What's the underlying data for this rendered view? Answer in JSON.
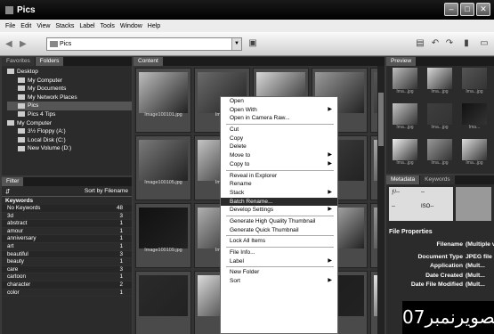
{
  "window": {
    "title": "Pics",
    "buttons": [
      "–",
      "□",
      "✕"
    ]
  },
  "menu": [
    "File",
    "Edit",
    "View",
    "Stacks",
    "Label",
    "Tools",
    "Window",
    "Help"
  ],
  "toolbar": {
    "path": "Pics"
  },
  "left": {
    "tabs": [
      "Favorites",
      "Folders"
    ],
    "tree": [
      "Desktop",
      "My Computer",
      "My Documents",
      "My Network Places",
      "Pics",
      "Pics 4 Tips",
      "My Computer",
      "3½ Floppy (A:)",
      "Local Disk (C:)",
      "New Volume (D:)"
    ],
    "filter_tab": "Filter",
    "sort": "Sort by Filename",
    "keywords_header": "Keywords",
    "keywords": [
      {
        "name": "No Keywords",
        "count": "48"
      },
      {
        "name": "3d",
        "count": "3"
      },
      {
        "name": "abstract",
        "count": "1"
      },
      {
        "name": "amour",
        "count": "1"
      },
      {
        "name": "anniversary",
        "count": "1"
      },
      {
        "name": "art",
        "count": "1"
      },
      {
        "name": "beautiful",
        "count": "3"
      },
      {
        "name": "beauty",
        "count": "1"
      },
      {
        "name": "care",
        "count": "3"
      },
      {
        "name": "cartoon",
        "count": "1"
      },
      {
        "name": "character",
        "count": "2"
      },
      {
        "name": "color",
        "count": "1"
      }
    ]
  },
  "content": {
    "tab": "Content",
    "captions": [
      "Image100101.jpg",
      "Image",
      "",
      "",
      "Image100104.jpg",
      "Image100105.jpg",
      "Image",
      "",
      "",
      "Image100108.jpg",
      "Image100109.jpg",
      "Image",
      "",
      "",
      "Image100112.jpg",
      "",
      "",
      "",
      "",
      ""
    ]
  },
  "context_menu": {
    "items": [
      {
        "label": "Open"
      },
      {
        "label": "Open With",
        "sub": "▶"
      },
      {
        "label": "Open in Camera Raw..."
      },
      {
        "sep": true
      },
      {
        "label": "Cut"
      },
      {
        "label": "Copy"
      },
      {
        "label": "Delete"
      },
      {
        "label": "Move to",
        "sub": "▶"
      },
      {
        "label": "Copy to",
        "sub": "▶"
      },
      {
        "sep": true
      },
      {
        "label": "Reveal in Explorer"
      },
      {
        "label": "Rename"
      },
      {
        "label": "Stack",
        "sub": "▶"
      },
      {
        "label": "Batch Rename...",
        "hl": true
      },
      {
        "label": "Develop Settings",
        "sub": "▶"
      },
      {
        "sep": true
      },
      {
        "label": "Generate High Quality Thumbnail"
      },
      {
        "label": "Generate Quick Thumbnail"
      },
      {
        "sep": true
      },
      {
        "label": "Lock All Items"
      },
      {
        "sep": true
      },
      {
        "label": "File Info..."
      },
      {
        "label": "Label",
        "sub": "▶"
      },
      {
        "sep": true
      },
      {
        "label": "New Folder"
      },
      {
        "label": "Sort",
        "sub": "▶"
      }
    ]
  },
  "right": {
    "preview_tab": "Preview",
    "preview_captions": [
      "Ima...jpg",
      "Ima...jpg",
      "Ima...jpg",
      "Ima...jpg",
      "Ima...jpg",
      "Ima...",
      "Ima...jpg",
      "Ima...jpg",
      "Ima...jpg"
    ],
    "meta_tabs": [
      "Metadata",
      "Keywords"
    ],
    "meta_grid": [
      "ƒ/--",
      "--",
      "--",
      "ISO--"
    ],
    "file_props": "File Properties",
    "props": [
      {
        "k": "Filename",
        "v": "(Multiple values)"
      },
      {
        "k": "Document Type",
        "v": "JPEG file"
      },
      {
        "k": "Application",
        "v": "(Mult..."
      },
      {
        "k": "Date Created",
        "v": "(Mult..."
      },
      {
        "k": "Date File Modified",
        "v": "(Mult..."
      }
    ]
  },
  "overlay": "تصویرنمبر07"
}
